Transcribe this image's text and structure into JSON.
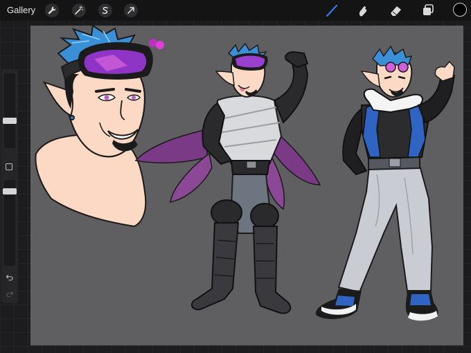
{
  "topbar": {
    "gallery_label": "Gallery",
    "left_tools": [
      {
        "icon": "wrench-icon",
        "name": "actions"
      },
      {
        "icon": "magic-wand-icon",
        "name": "adjustments"
      },
      {
        "icon": "selection-s-icon",
        "name": "selection"
      },
      {
        "icon": "arrow-cursor-icon",
        "name": "transform"
      }
    ],
    "right_tools": [
      {
        "icon": "brush-icon",
        "name": "paint",
        "active": true,
        "color": "#2f7cf6"
      },
      {
        "icon": "smudge-icon",
        "name": "smudge"
      },
      {
        "icon": "eraser-icon",
        "name": "eraser"
      },
      {
        "icon": "layers-icon",
        "name": "layers"
      }
    ],
    "current_color": "#000000"
  },
  "sidebar": {
    "brush_size_slider": 0.21,
    "opacity_slider": 0.06
  },
  "canvas": {
    "background": "#5f5f61",
    "color_dots": [
      "#c030c0",
      "#e040d8"
    ]
  }
}
